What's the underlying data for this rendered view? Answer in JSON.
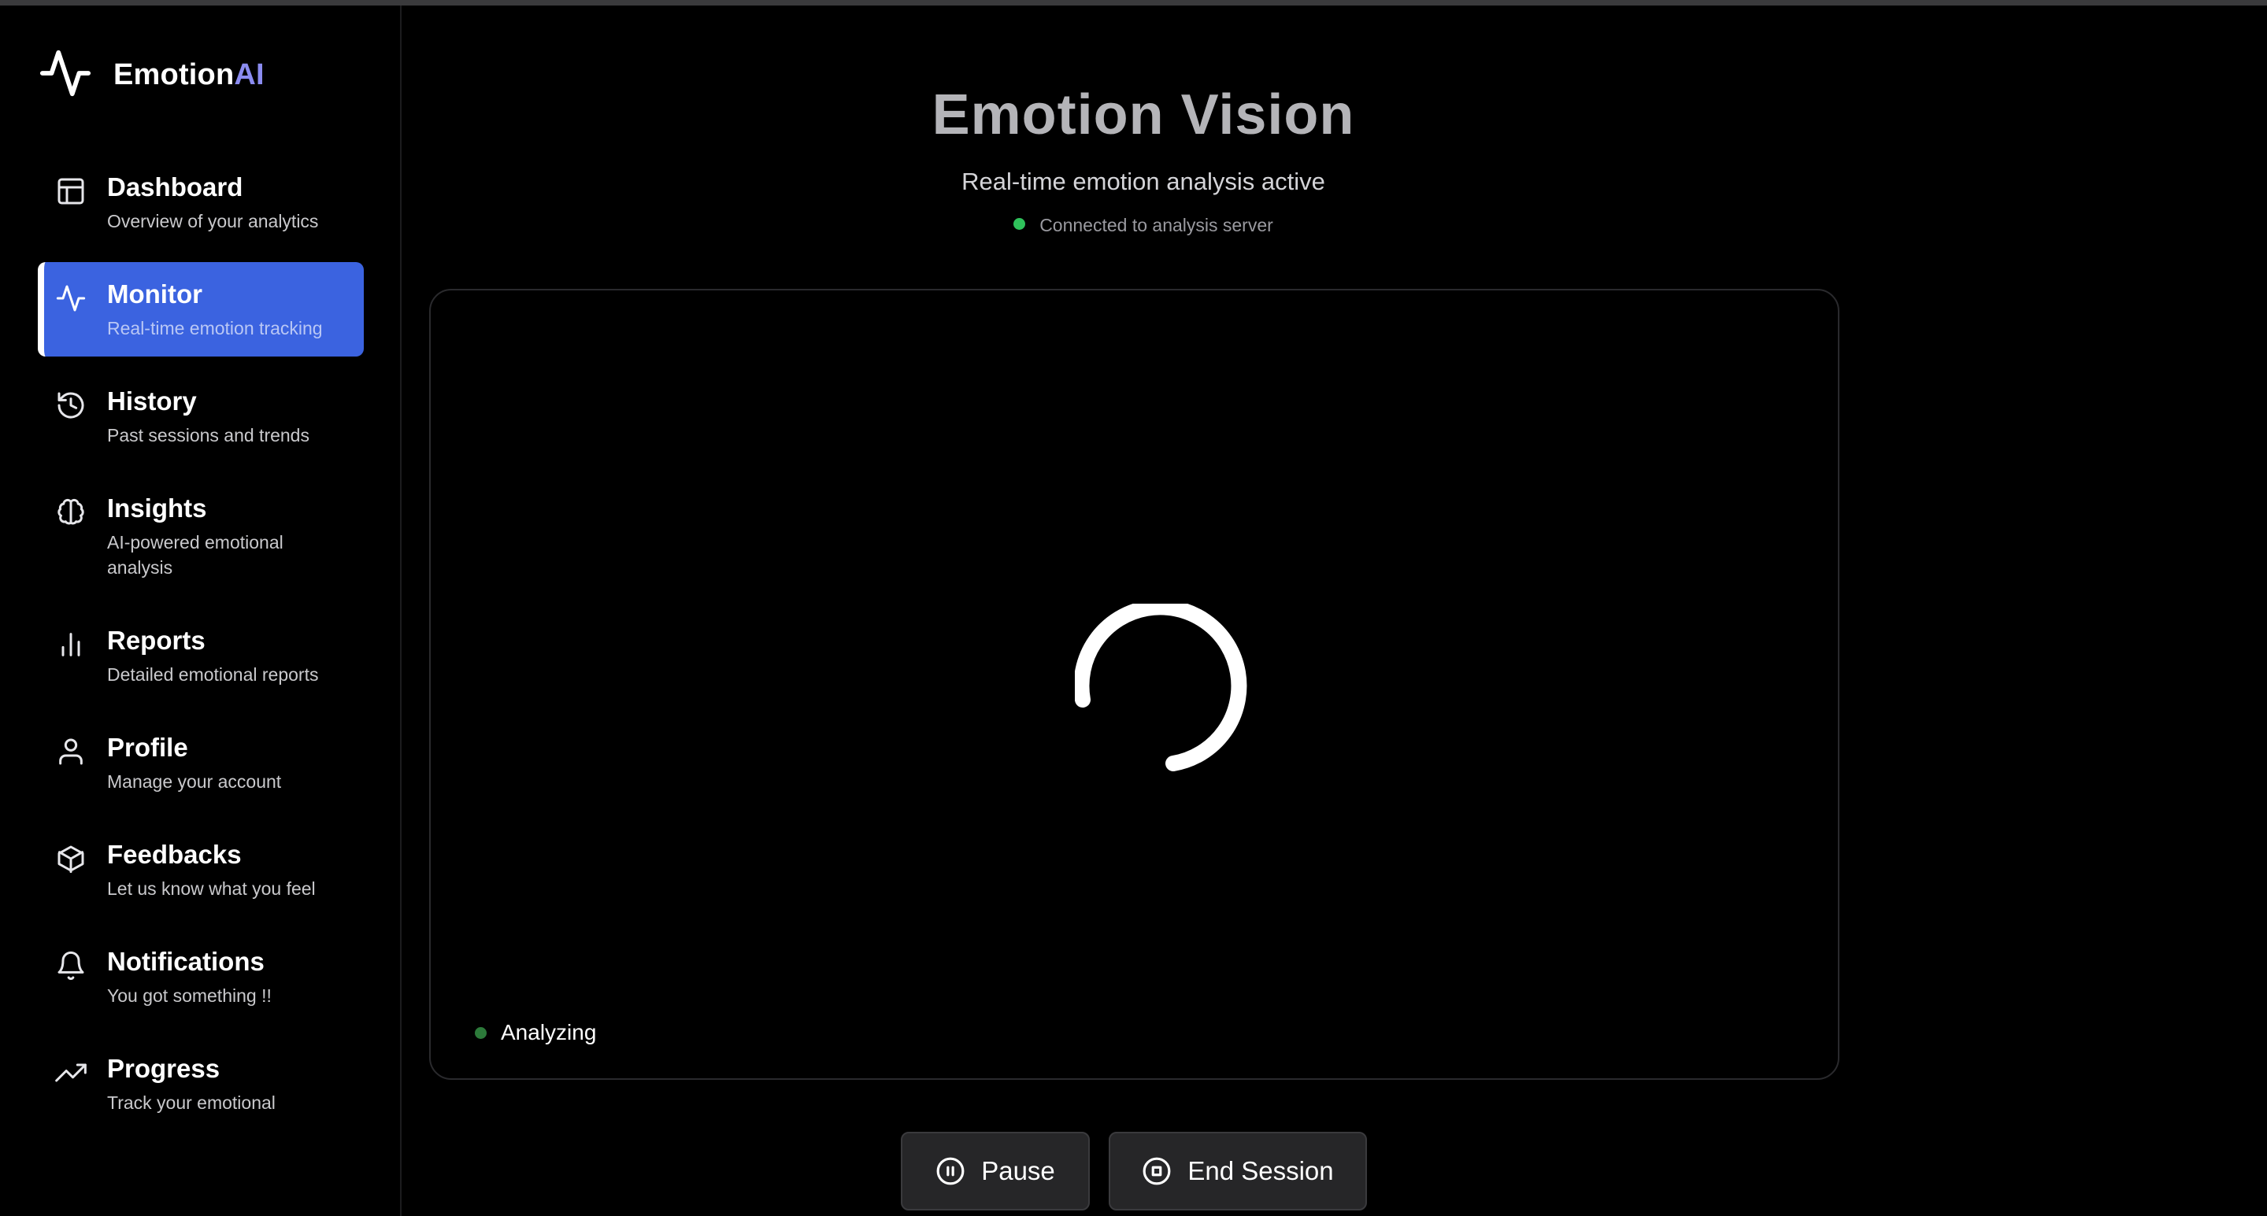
{
  "brand": {
    "name_part1": "Emotion",
    "name_part2": "AI"
  },
  "nav": {
    "items": [
      {
        "label": "Dashboard",
        "desc": "Overview of your analytics",
        "icon": "layout-icon",
        "active": false
      },
      {
        "label": "Monitor",
        "desc": "Real-time emotion tracking",
        "icon": "activity-icon",
        "active": true
      },
      {
        "label": "History",
        "desc": "Past sessions and trends",
        "icon": "history-icon",
        "active": false
      },
      {
        "label": "Insights",
        "desc": "AI-powered emotional analysis",
        "icon": "brain-icon",
        "active": false
      },
      {
        "label": "Reports",
        "desc": "Detailed emotional reports",
        "icon": "bar-chart-icon",
        "active": false
      },
      {
        "label": "Profile",
        "desc": "Manage your account",
        "icon": "user-icon",
        "active": false
      },
      {
        "label": "Feedbacks",
        "desc": "Let us know what you feel",
        "icon": "box-icon",
        "active": false
      },
      {
        "label": "Notifications",
        "desc": "You got something !!",
        "icon": "bell-icon",
        "active": false
      },
      {
        "label": "Progress",
        "desc": "Track your emotional",
        "icon": "trending-up-icon",
        "active": false
      }
    ]
  },
  "main": {
    "title": "Emotion Vision",
    "subtitle": "Real-time emotion analysis active",
    "connection_status": "Connected to analysis server",
    "video": {
      "status": "Analyzing"
    },
    "buttons": {
      "pause": "Pause",
      "end_session": "End Session"
    }
  },
  "colors": {
    "accent": "#3b63e0",
    "brand_ai": "#8b8cf0",
    "connected": "#2fc25b",
    "analyzing": "#2c7a3a",
    "background": "#000000"
  }
}
